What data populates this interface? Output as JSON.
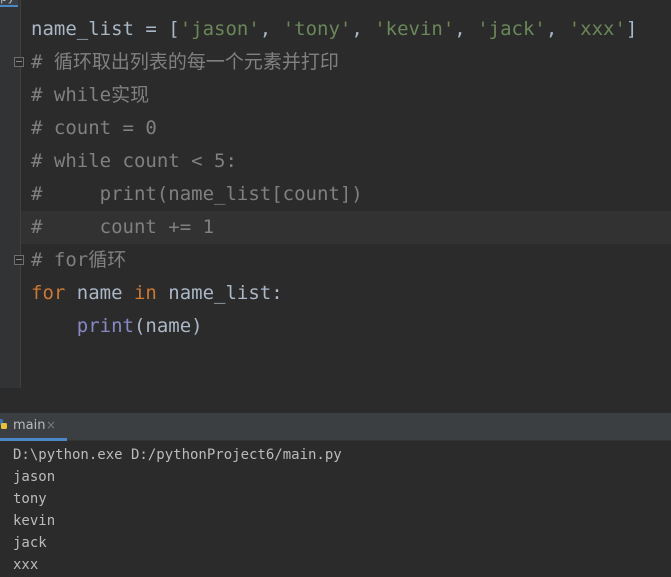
{
  "file_tab": {
    "label": "py"
  },
  "code_lines": [
    [
      {
        "t": "name_list = [",
        "c": ""
      },
      {
        "t": "'jason'",
        "c": "str"
      },
      {
        "t": ", ",
        "c": ""
      },
      {
        "t": "'tony'",
        "c": "str"
      },
      {
        "t": ", ",
        "c": ""
      },
      {
        "t": "'kevin'",
        "c": "str"
      },
      {
        "t": ", ",
        "c": ""
      },
      {
        "t": "'jack'",
        "c": "str"
      },
      {
        "t": ", ",
        "c": ""
      },
      {
        "t": "'xxx'",
        "c": "str"
      },
      {
        "t": "]",
        "c": ""
      }
    ],
    [
      {
        "t": "# 循环取出列表的每一个元素并打印",
        "c": "cm"
      }
    ],
    [
      {
        "t": "# while实现",
        "c": "cm"
      }
    ],
    [
      {
        "t": "# count = 0",
        "c": "cm"
      }
    ],
    [
      {
        "t": "# while count < 5:",
        "c": "cm"
      }
    ],
    [
      {
        "t": "#     print(name_list[count])",
        "c": "cm"
      }
    ],
    [
      {
        "t": "#     count += 1",
        "c": "cm"
      }
    ],
    [
      {
        "t": "# for循环",
        "c": "cm"
      }
    ],
    [
      {
        "t": "for",
        "c": "kw"
      },
      {
        "t": " name ",
        "c": ""
      },
      {
        "t": "in",
        "c": "kw"
      },
      {
        "t": " name_list:",
        "c": ""
      }
    ],
    [
      {
        "t": "    ",
        "c": ""
      },
      {
        "t": "print",
        "c": "bi"
      },
      {
        "t": "(name)",
        "c": ""
      }
    ]
  ],
  "current_line_index": 6,
  "run_panel": {
    "tab_label": "main",
    "output": [
      "D:\\python.exe D:/pythonProject6/main.py",
      "jason",
      "tony",
      "kevin",
      "jack",
      "xxx"
    ]
  }
}
